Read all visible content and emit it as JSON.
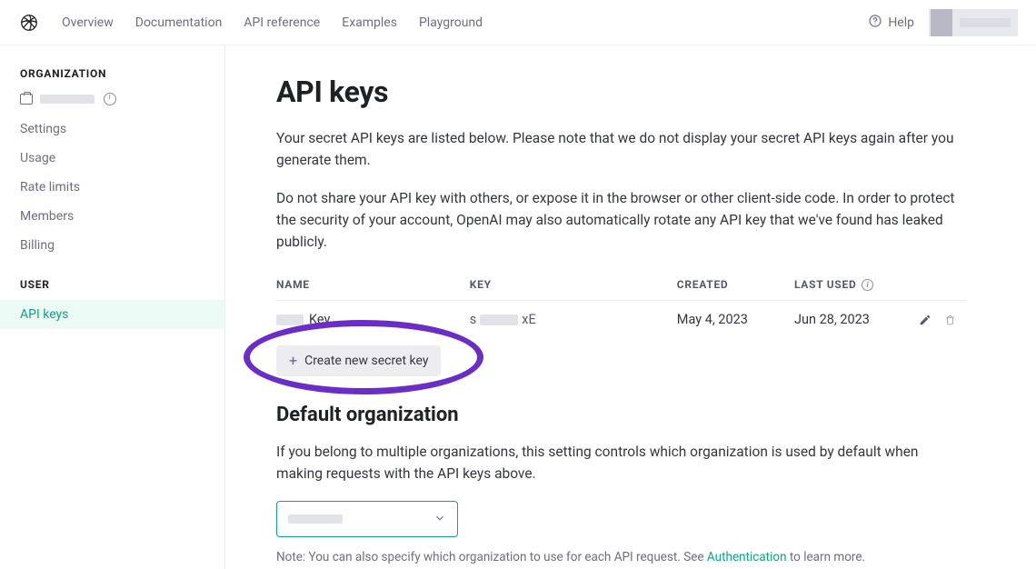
{
  "nav": {
    "links": [
      "Overview",
      "Documentation",
      "API reference",
      "Examples",
      "Playground"
    ],
    "help": "Help"
  },
  "sidebar": {
    "org_header": "ORGANIZATION",
    "org_items": [
      "Settings",
      "Usage",
      "Rate limits",
      "Members",
      "Billing"
    ],
    "user_header": "USER",
    "user_items": [
      "API keys"
    ]
  },
  "page": {
    "title": "API keys",
    "para1": "Your secret API keys are listed below. Please note that we do not display your secret API keys again after you generate them.",
    "para2": "Do not share your API key with others, or expose it in the browser or other client-side code. In order to protect the security of your account, OpenAI may also automatically rotate any API key that we've found has leaked publicly."
  },
  "table": {
    "cols": {
      "name": "NAME",
      "key": "KEY",
      "created": "CREATED",
      "last_used": "LAST USED"
    },
    "rows": [
      {
        "name_suffix": "Key",
        "key_prefix": "s",
        "key_suffix": "xE",
        "created": "May 4, 2023",
        "last_used": "Jun 28, 2023"
      }
    ]
  },
  "create_button": "Create new secret key",
  "default_org": {
    "heading": "Default organization",
    "para": "If you belong to multiple organizations, this setting controls which organization is used by default when making requests with the API keys above.",
    "note_pre": "Note: You can also specify which organization to use for each API request. See ",
    "note_link": "Authentication",
    "note_post": " to learn more."
  }
}
